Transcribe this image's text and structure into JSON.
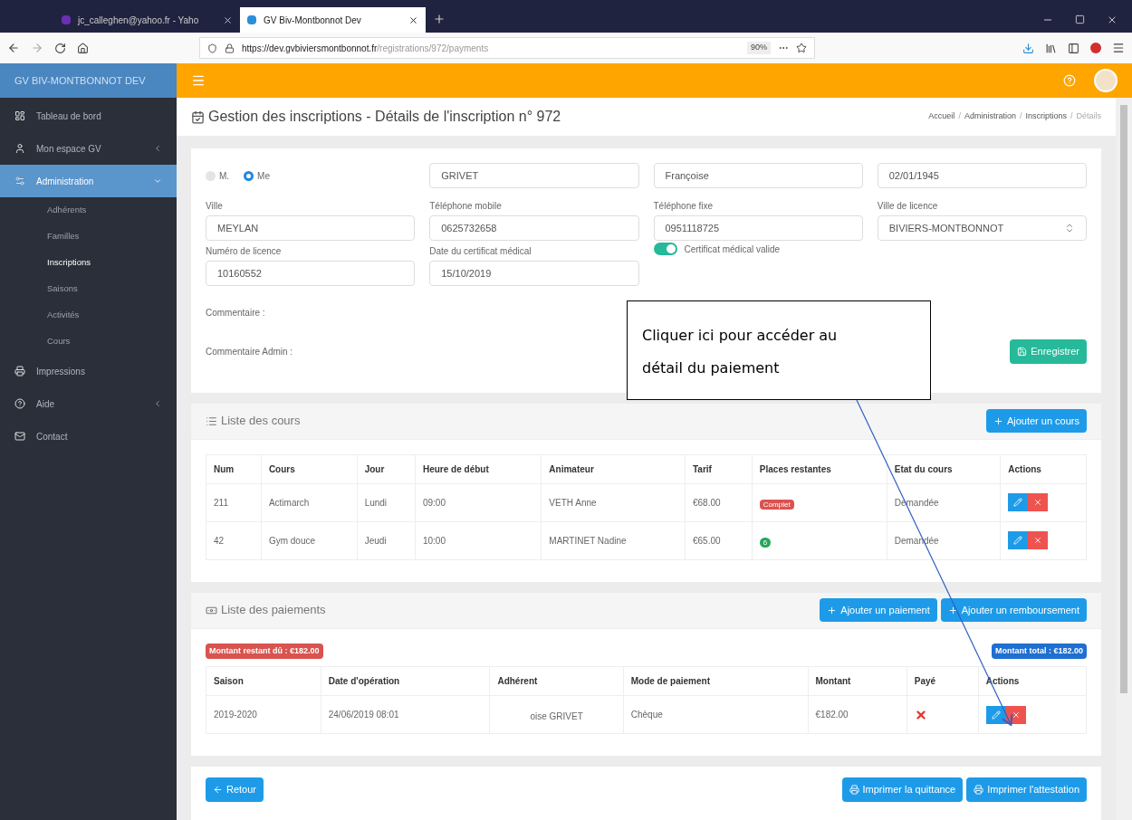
{
  "browser": {
    "tabs": [
      {
        "title": "jc_calleghen@yahoo.fr - Yaho",
        "selected": false
      },
      {
        "title": "GV Biv-Montbonnot Dev",
        "selected": true
      }
    ],
    "url_host": "https://dev.gvbiviersmontbonnot.fr",
    "url_path": "/registrations/972/payments",
    "zoom": "90%"
  },
  "app": {
    "brand": "GV BIV-MONTBONNOT DEV"
  },
  "sidebar": [
    {
      "label": "Tableau de bord",
      "kind": "dashboard",
      "selected": false
    },
    {
      "label": "Mon espace GV",
      "kind": "user",
      "selected": false,
      "expanded": false
    },
    {
      "label": "Administration",
      "kind": "admin",
      "selected": true,
      "expanded": true,
      "children": [
        {
          "label": "Adhérents",
          "selected": false
        },
        {
          "label": "Familles",
          "selected": false
        },
        {
          "label": "Inscriptions",
          "selected": true
        },
        {
          "label": "Saisons",
          "selected": false
        },
        {
          "label": "Activités",
          "selected": false
        },
        {
          "label": "Cours",
          "selected": false
        }
      ]
    },
    {
      "label": "Impressions",
      "kind": "print",
      "selected": false
    },
    {
      "label": "Aide",
      "kind": "help",
      "selected": false,
      "expanded": false
    },
    {
      "label": "Contact",
      "kind": "mail",
      "selected": false
    }
  ],
  "page_title": "Gestion des inscriptions - Détails de l'inscription n° 972",
  "breadcrumb_separator": "/",
  "breadcrumb": [
    {
      "label": "Accueil",
      "selected": false
    },
    {
      "label": "Administration",
      "selected": false
    },
    {
      "label": "Inscriptions",
      "selected": false
    },
    {
      "label": "Détails",
      "selected": true
    }
  ],
  "form": {
    "civility": [
      {
        "label": "M.",
        "selected": false
      },
      {
        "label": "Me",
        "selected": true
      }
    ],
    "identity": [
      "GRIVET",
      "Françoise",
      "02/01/1945"
    ],
    "fields": [
      {
        "label": "Ville",
        "value": "MEYLAN",
        "kind": "text"
      },
      {
        "label": "Téléphone mobile",
        "value": "0625732658",
        "kind": "text"
      },
      {
        "label": "Téléphone fixe",
        "value": "0951118725",
        "kind": "text"
      },
      {
        "label": "Ville de licence",
        "value": "BIVIERS-MONTBONNOT",
        "kind": "select"
      },
      {
        "label": "Numéro de licence",
        "value": "10160552",
        "kind": "text"
      },
      {
        "label": "Date du certificat médical",
        "value": "15/10/2019",
        "kind": "text"
      }
    ],
    "certificate": {
      "label": "Certificat médical valide",
      "on": true
    },
    "comments": [
      "Commentaire :",
      "Commentaire Admin :"
    ],
    "save_button": "Enregistrer"
  },
  "courses": {
    "title": "Liste des cours",
    "add_button": "Ajouter un cours",
    "columns": [
      "Num",
      "Cours",
      "Jour",
      "Heure de début",
      "Animateur",
      "Tarif",
      "Places restantes",
      "Etat du cours",
      "Actions"
    ],
    "rows": [
      {
        "num": "211",
        "course": "Actimarch",
        "day": "Lundi",
        "start": "09:00",
        "instructor": "VETH Anne",
        "price": "€68.00",
        "places": {
          "text": "Complet",
          "kind": "full"
        },
        "status": "Demandée"
      },
      {
        "num": "42",
        "course": "Gym douce",
        "day": "Jeudi",
        "start": "10:00",
        "instructor": "MARTINET Nadine",
        "price": "€65.00",
        "places": {
          "text": "6",
          "kind": "available"
        },
        "status": "Demandée"
      }
    ]
  },
  "payments": {
    "title": "Liste des paiements",
    "buttons": [
      "Ajouter un paiement",
      "Ajouter un remboursement"
    ],
    "remaining": "Montant restant dû : €182.00",
    "total": "Montant total : €182.00",
    "columns": [
      "Saison",
      "Date d'opération",
      "Adhérent",
      "Mode de paiement",
      "Montant",
      "Payé",
      "Actions"
    ],
    "rows": [
      {
        "season": "2019-2020",
        "date": "24/06/2019 08:01",
        "member": "oise GRIVET",
        "method": "Chèque",
        "amount": "€182.00",
        "paid": false
      }
    ]
  },
  "footer": {
    "back": "Retour",
    "prints": [
      "Imprimer la quittance",
      "Imprimer l'attestation"
    ]
  },
  "callout": {
    "text": "Cliquer ici pour accéder au détail du paiement"
  }
}
